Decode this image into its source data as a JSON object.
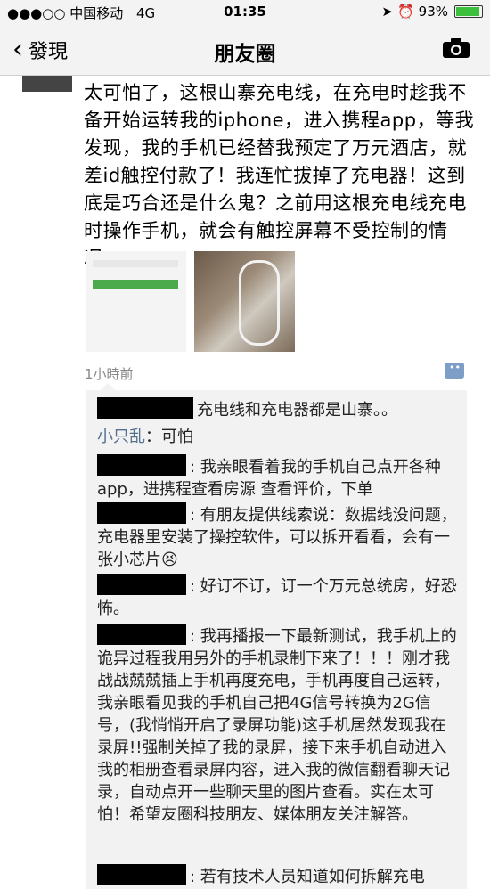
{
  "status_bar": {
    "carrier": "●●●○○ 中国移动",
    "network": "4G",
    "time": "01:35",
    "battery": "93%",
    "battery_level": 0.93
  },
  "nav": {
    "back_label": "發現",
    "title": "朋友圈"
  },
  "post": {
    "text": "太可怕了，这根山寨充电线，在充电时趁我不备开始运转我的iphone，进入携程app，等我发现，我的手机已经替我预定了万元酒店，就差id触控付款了！我连忙拔掉了充电器！这到底是巧合还是什么鬼？之前用这根充电线充电时操作手机，就会有触控屏幕不受控制的情况。",
    "time": "1小時前"
  },
  "comments": [
    {
      "name": "",
      "text": "充电线和充电器都是山寨。。"
    },
    {
      "name": "小只乱",
      "text": "：可怕"
    },
    {
      "name": "",
      "text": ": 我亲眼看着我的手机自己点开各种app，进携程查看房源 查看评价，下单"
    },
    {
      "name": "",
      "text": ": 有朋友提供线索说：数据线没问题，充电器里安装了操控软件，可以拆开看看，会有一张小芯片😣"
    },
    {
      "name": "",
      "text": ": 好订不订，订一个万元总统房，好恐怖。"
    },
    {
      "name": "",
      "text": ": 我再播报一下最新测试，我手机上的诡异过程我用另外的手机录制下来了！！！刚才我战战兢兢插上手机再度充电，手机再度自己运转，我亲眼看见我的手机自己把4G信号转换为2G信号，(我悄悄开启了录屏功能)这手机居然发现我在录屏!!强制关掉了我的录屏，接下来手机自动进入我的相册查看录屏内容，进入我的微信翻看聊天记录，自动点开一些聊天里的图片查看。实在太可怕！希望友圈科技朋友、媒体朋友关注解答。"
    },
    {
      "name": "",
      "text": ": 若有技术人员知道如何拆解充电"
    }
  ]
}
